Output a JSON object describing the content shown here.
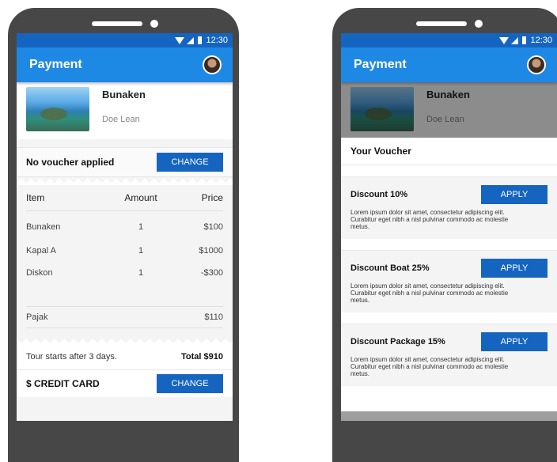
{
  "status": {
    "time": "12:30"
  },
  "appbar": {
    "title": "Payment"
  },
  "tour": {
    "name": "Bunaken",
    "host": "Doe Lean"
  },
  "left": {
    "voucher_label": "No voucher applied",
    "change_label": "CHANGE",
    "columns": [
      "Item",
      "Amount",
      "Price"
    ],
    "rows": [
      {
        "item": "Bunaken",
        "amount": "1",
        "price": "$100"
      },
      {
        "item": "Kapal A",
        "amount": "1",
        "price": "$1000"
      },
      {
        "item": "Diskon",
        "amount": "1",
        "price": "-$300"
      }
    ],
    "tax": {
      "label": "Pajak",
      "price": "$110"
    },
    "note": "Tour starts after 3 days.",
    "total": "Total $910",
    "payment_label": "$ CREDIT CARD",
    "payment_change_label": "CHANGE"
  },
  "right": {
    "title": "Your Voucher",
    "apply_label": "APPLY",
    "vouchers": [
      {
        "name": "Discount 10%",
        "desc": "Lorem ipsum dolor sit amet, consectetur adipiscing elit. Curabitur eget nibh a nisl pulvinar commodo ac molestie metus."
      },
      {
        "name": "Discount Boat 25%",
        "desc": "Lorem ipsum dolor sit amet, consectetur adipiscing elit. Curabitur eget nibh a nisl pulvinar commodo ac molestie metus."
      },
      {
        "name": "Discount Package 15%",
        "desc": "Lorem ipsum dolor sit amet, consectetur adipiscing elit. Curabitur eget nibh a nisl pulvinar commodo ac molestie metus."
      }
    ]
  }
}
